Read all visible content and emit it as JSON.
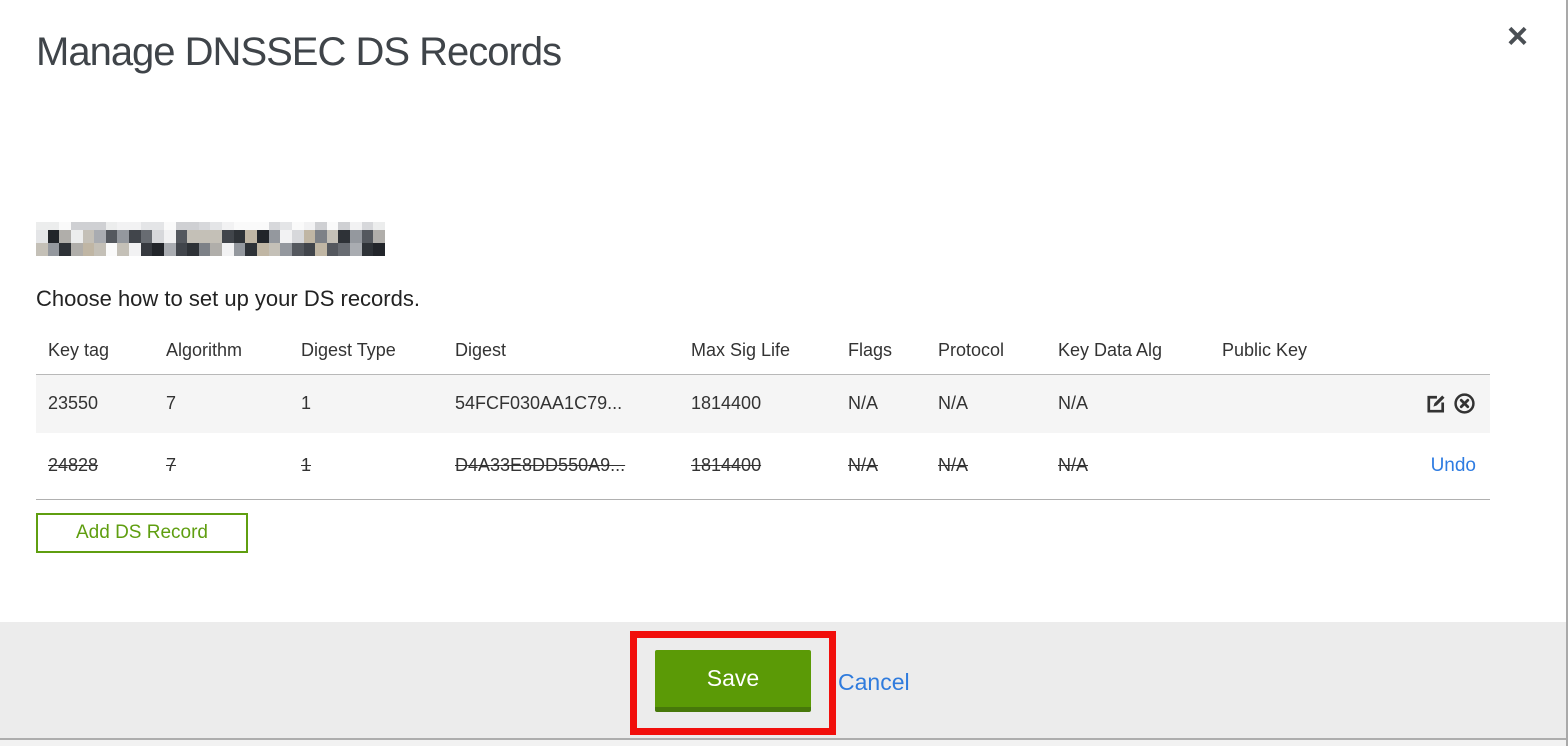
{
  "dialog": {
    "title": "Manage DNSSEC DS Records",
    "close_glyph": "×",
    "instruction": "Choose how to set up your DS records.",
    "domain_redacted": true
  },
  "table": {
    "columns": [
      "Key tag",
      "Algorithm",
      "Digest Type",
      "Digest",
      "Max Sig Life",
      "Flags",
      "Protocol",
      "Key Data Alg",
      "Public Key",
      ""
    ],
    "rows": [
      {
        "key_tag": "23550",
        "algorithm": "7",
        "digest_type": "1",
        "digest": "54FCF030AA1C79...",
        "max_sig_life": "1814400",
        "flags": "N/A",
        "protocol": "N/A",
        "key_data_alg": "N/A",
        "public_key": "",
        "state": "normal"
      },
      {
        "key_tag": "24828",
        "algorithm": "7",
        "digest_type": "1",
        "digest": "D4A33E8DD550A9...",
        "max_sig_life": "1814400",
        "flags": "N/A",
        "protocol": "N/A",
        "key_data_alg": "N/A",
        "public_key": "",
        "state": "deleted",
        "undo_label": "Undo"
      }
    ]
  },
  "buttons": {
    "add_ds_record": "Add DS Record",
    "save": "Save",
    "cancel": "Cancel"
  },
  "colors": {
    "button_green": "#5f9e10",
    "save_green": "#5b9a06",
    "link_blue": "#2f7bdd",
    "annotation_red": "#f10f0c"
  }
}
